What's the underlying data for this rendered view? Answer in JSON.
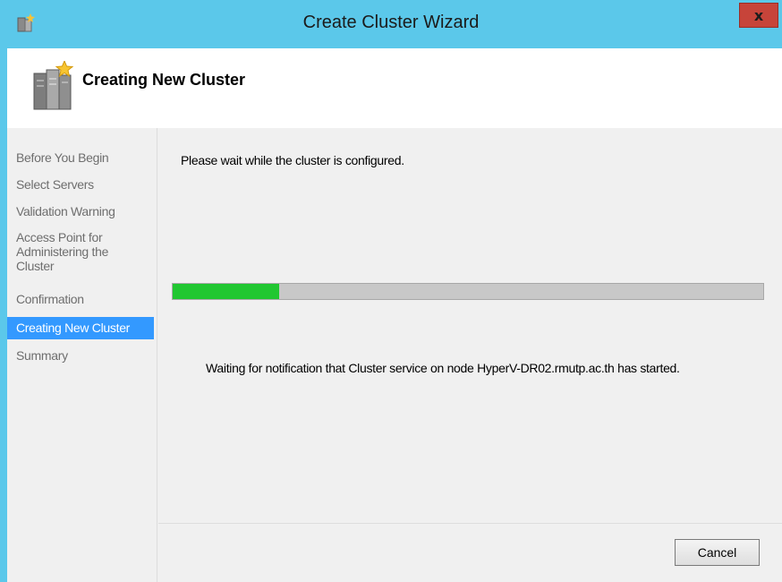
{
  "window": {
    "title": "Create Cluster Wizard",
    "close_glyph": "x",
    "title_icon": "wizard-icon",
    "accent_color": "#5bc8ea"
  },
  "header": {
    "title": "Creating New Cluster",
    "icon": "cluster-servers-icon"
  },
  "sidebar": {
    "items": [
      {
        "label": "Before You Begin"
      },
      {
        "label": "Select Servers"
      },
      {
        "label": "Validation Warning"
      },
      {
        "label": "Access Point for Administering the Cluster"
      },
      {
        "label": "Confirmation"
      },
      {
        "label": "Creating New Cluster",
        "active": true
      },
      {
        "label": "Summary"
      }
    ]
  },
  "main": {
    "instruction": "Please wait while the cluster is configured.",
    "progress_percent": 18,
    "progress_color": "#21c731",
    "status": "Waiting for notification that Cluster service on node HyperV-DR02.rmutp.ac.th has started."
  },
  "footer": {
    "cancel_label": "Cancel"
  }
}
